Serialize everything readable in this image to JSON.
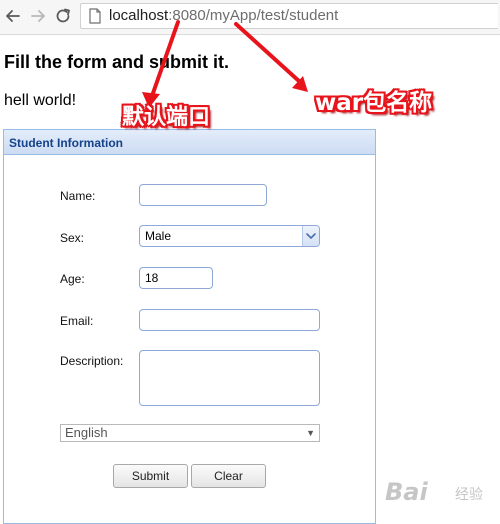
{
  "browser": {
    "url_host": "localhost",
    "url_rest": ":8080/myApp/test/student",
    "icons": {
      "back": "arrow-left-icon",
      "forward": "arrow-right-icon",
      "reload": "reload-icon",
      "page": "page-icon"
    }
  },
  "page": {
    "heading": "Fill the form and submit it.",
    "greeting": "hell world!"
  },
  "panel": {
    "title": "Student Information",
    "fields": {
      "name_label": "Name:",
      "name_value": "",
      "sex_label": "Sex:",
      "sex_value": "Male",
      "age_label": "Age:",
      "age_value": "18",
      "email_label": "Email:",
      "email_value": "",
      "description_label": "Description:",
      "description_value": ""
    },
    "language_value": "English",
    "buttons": {
      "submit": "Submit",
      "clear": "Clear"
    }
  },
  "annotations": {
    "port_label": "默认端口",
    "war_label": "war包名称",
    "color": "#e8141b"
  },
  "watermark": {
    "main": "Bai",
    "sub": "经验"
  }
}
